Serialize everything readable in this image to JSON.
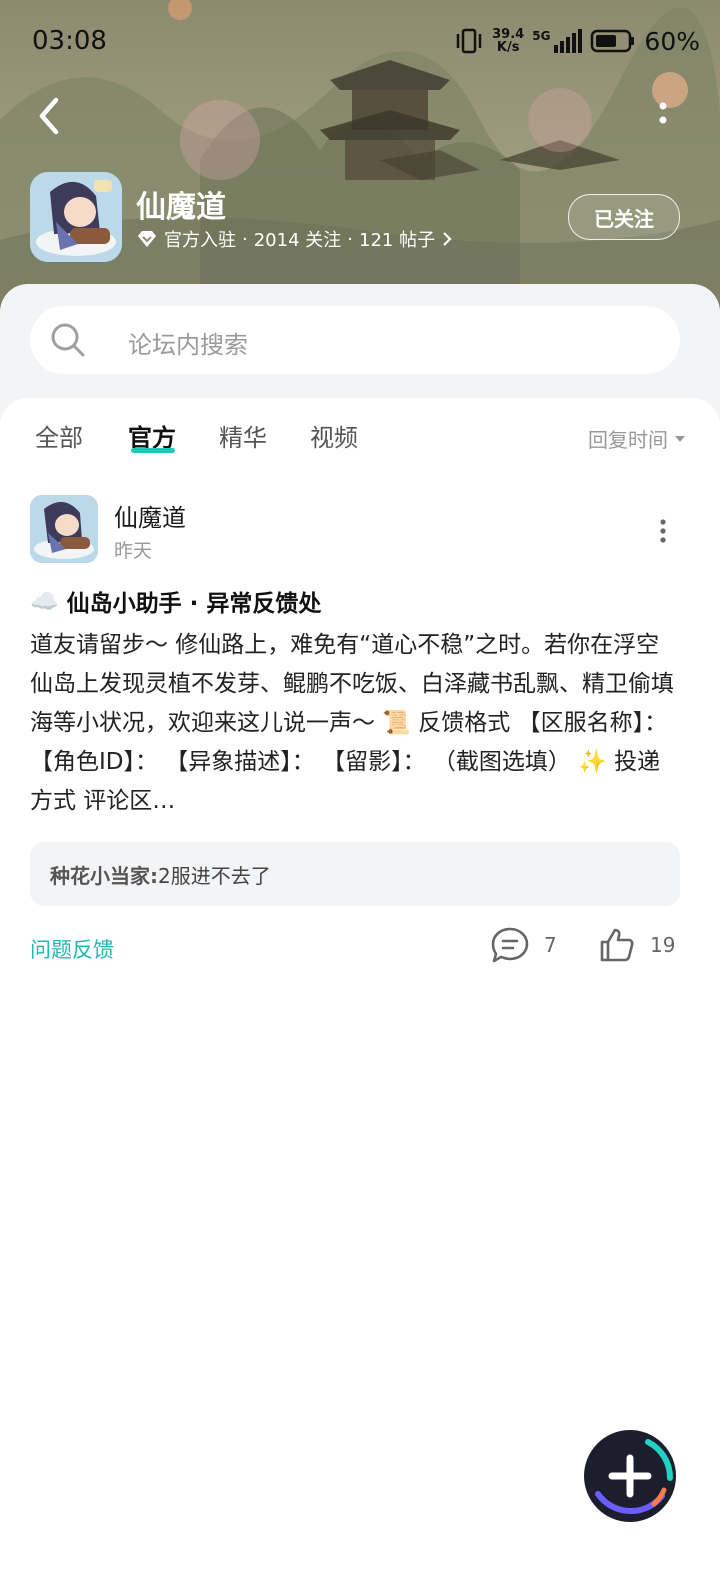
{
  "status_bar": {
    "time": "03:08",
    "net_speed_value": "39.4",
    "net_speed_unit": "K/s",
    "network": "5G",
    "battery": "60%"
  },
  "header": {
    "forum_name": "仙魔道",
    "official_label": "官方入驻",
    "follows": "2014 关注",
    "posts": "121 帖子",
    "separator": "·",
    "follow_button": "已关注"
  },
  "search": {
    "placeholder": "论坛内搜索"
  },
  "tabs": [
    {
      "label": "全部",
      "active": false
    },
    {
      "label": "官方",
      "active": true
    },
    {
      "label": "精华",
      "active": false
    },
    {
      "label": "视频",
      "active": false
    }
  ],
  "sort": {
    "label": "回复时间"
  },
  "post": {
    "author": "仙魔道",
    "time": "昨天",
    "title_emoji": "☁️",
    "title": "仙岛小助手 · 异常反馈处",
    "body": "道友请留步～ 修仙路上，难免有“道心不稳”之时。若你在浮空仙岛上发现灵植不发芽、鲲鹏不吃饭、白泽藏书乱飘、精卫偷填海等小状况，欢迎来这儿说一声～ 📜 反馈格式 【区服名称】： 【角色ID】： 【异象描述】： 【留影】： （截图选填） ✨ 投递方式 评论区…",
    "reply_user": "种花小当家:",
    "reply_text": "2服进不去了",
    "tag": "问题反馈",
    "comments": "7",
    "likes": "19"
  },
  "colors": {
    "accent": "#20b8b0",
    "tab_underline": "#1fc8b8"
  },
  "icons": [
    "back-icon",
    "more-vert-icon",
    "verified-diamond-icon",
    "chevron-right-icon",
    "search-icon",
    "sort-caret-icon",
    "comment-icon",
    "like-icon",
    "plus-icon"
  ]
}
